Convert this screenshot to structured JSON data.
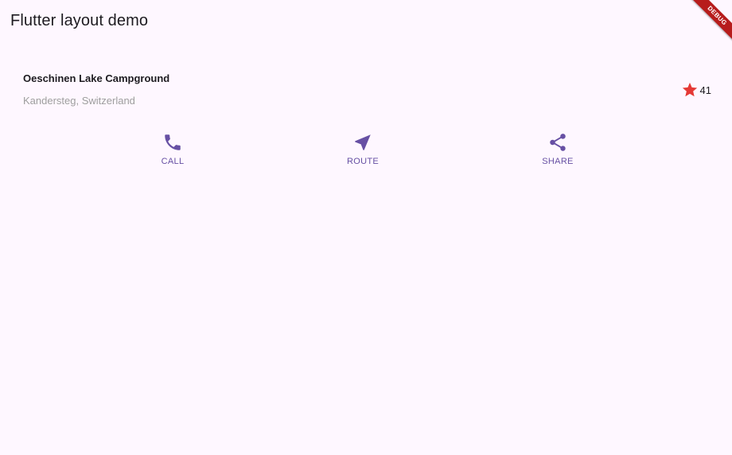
{
  "app_bar": {
    "title": "Flutter layout demo"
  },
  "title_section": {
    "name": "Oeschinen Lake Campground",
    "location": "Kandersteg, Switzerland",
    "rating_count": "41",
    "star_icon": "star-icon",
    "star_color": "#e53935"
  },
  "buttons": {
    "accent_color": "#6750a4",
    "call": {
      "label": "CALL",
      "icon": "phone-icon"
    },
    "route": {
      "label": "ROUTE",
      "icon": "navigation-icon"
    },
    "share": {
      "label": "SHARE",
      "icon": "share-icon"
    }
  },
  "debug_banner": {
    "label": "DEBUG",
    "color": "#b71c1c"
  }
}
